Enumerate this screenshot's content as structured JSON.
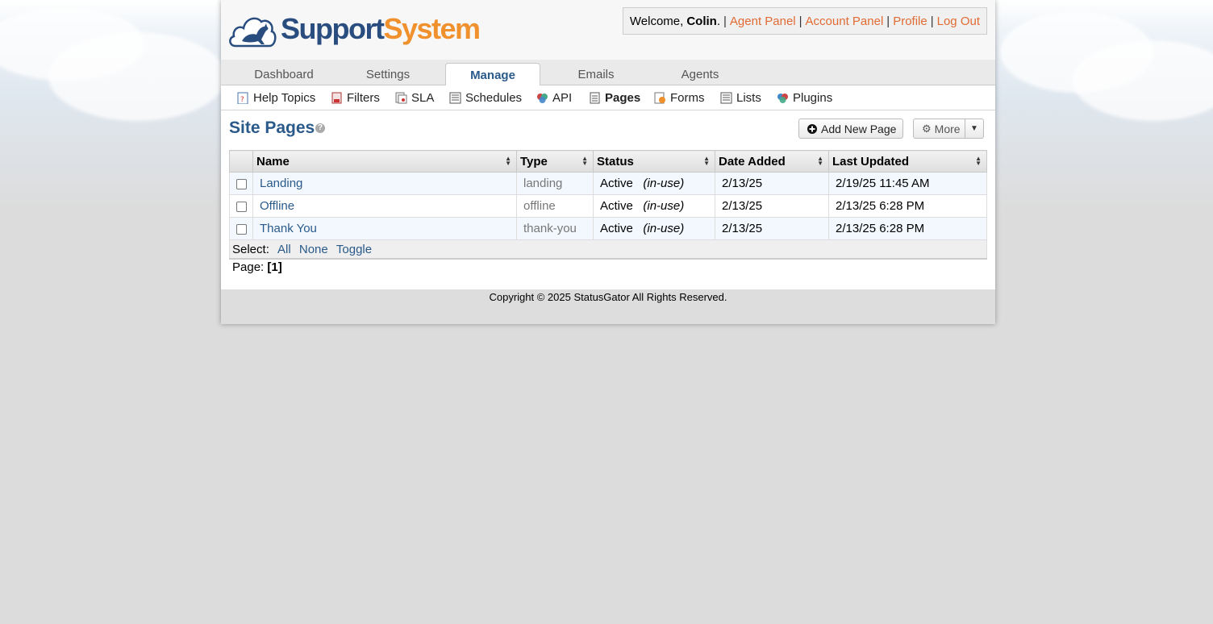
{
  "logo": {
    "part1": "Support",
    "part2": "System"
  },
  "user": {
    "welcome_prefix": "Welcome,",
    "name": "Colin",
    "name_suffix": ".",
    "links": [
      "Agent Panel",
      "Account Panel",
      "Profile",
      "Log Out"
    ],
    "separator": "|"
  },
  "nav": {
    "tabs": [
      {
        "label": "Dashboard",
        "active": false
      },
      {
        "label": "Settings",
        "active": false
      },
      {
        "label": "Manage",
        "active": true
      },
      {
        "label": "Emails",
        "active": false
      },
      {
        "label": "Agents",
        "active": false
      }
    ]
  },
  "subnav": {
    "items": [
      {
        "label": "Help Topics",
        "icon": "help-topics-icon"
      },
      {
        "label": "Filters",
        "icon": "filters-icon"
      },
      {
        "label": "SLA",
        "icon": "sla-icon"
      },
      {
        "label": "Schedules",
        "icon": "schedules-icon"
      },
      {
        "label": "API",
        "icon": "api-icon"
      },
      {
        "label": "Pages",
        "icon": "pages-icon",
        "active": true
      },
      {
        "label": "Forms",
        "icon": "forms-icon"
      },
      {
        "label": "Lists",
        "icon": "lists-icon"
      },
      {
        "label": "Plugins",
        "icon": "plugins-icon"
      }
    ]
  },
  "page": {
    "title": "Site Pages",
    "help": "?",
    "add_button": "Add New Page",
    "more_button": "More"
  },
  "table": {
    "columns": [
      "Name",
      "Type",
      "Status",
      "Date Added",
      "Last Updated"
    ],
    "rows": [
      {
        "name": "Landing",
        "type": "landing",
        "status": "Active",
        "usage": "(in-use)",
        "date_added": "2/13/25",
        "last_updated": "2/19/25 11:45 AM"
      },
      {
        "name": "Offline",
        "type": "offline",
        "status": "Active",
        "usage": "(in-use)",
        "date_added": "2/13/25",
        "last_updated": "2/13/25 6:28 PM"
      },
      {
        "name": "Thank You",
        "type": "thank-you",
        "status": "Active",
        "usage": "(in-use)",
        "date_added": "2/13/25",
        "last_updated": "2/13/25 6:28 PM"
      }
    ],
    "select_label": "Select:",
    "select_links": [
      "All",
      "None",
      "Toggle"
    ]
  },
  "pagination": {
    "label": "Page:",
    "current": "[1]"
  },
  "footer": {
    "copyright": "Copyright © 2025 StatusGator All Rights Reserved."
  },
  "colors": {
    "brand_blue": "#2a4d7f",
    "brand_orange": "#f0912e",
    "link": "#2a5a8a",
    "header_link": "#e06b34"
  }
}
